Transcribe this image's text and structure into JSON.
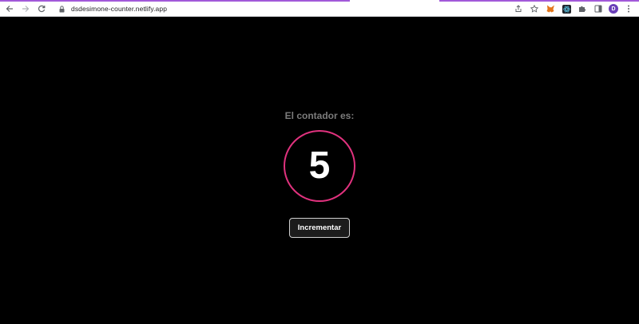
{
  "browser": {
    "url": "dsdesimone-counter.netlify.app",
    "profile_initial": "D",
    "icons": {
      "back": "arrow-left-icon",
      "forward": "arrow-right-icon",
      "reload": "reload-icon",
      "lock": "lock-icon",
      "share": "share-icon",
      "bookmark": "star-icon",
      "ext1": "metamask-fox-icon",
      "ext2": "react-devtools-icon",
      "extensions": "puzzle-icon",
      "sidepanel": "side-panel-icon",
      "menu": "kebab-menu-icon"
    }
  },
  "app": {
    "label": "El contador es:",
    "count": "5",
    "button_label": "Incrementar"
  },
  "colors": {
    "background": "#000000",
    "circle_border": "#e0327e",
    "label": "#7b7b7b",
    "accent_top": "#a259d9"
  }
}
